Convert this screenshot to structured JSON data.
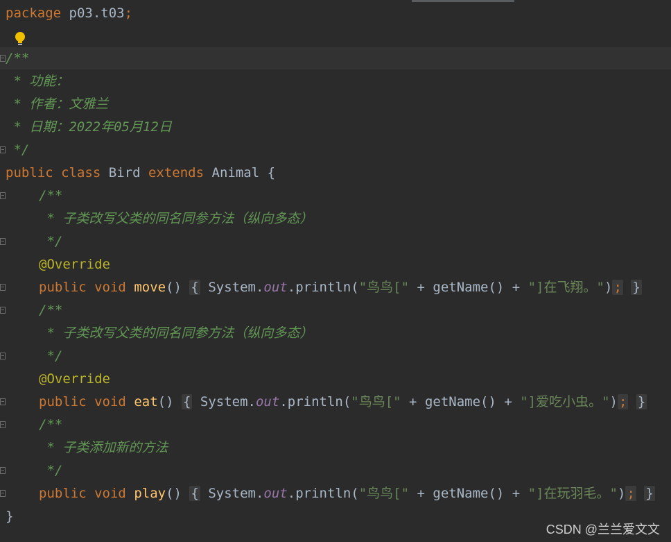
{
  "editor": {
    "lines": {
      "package_kw": "package",
      "package_name": " p03.t03",
      "package_semi": ";",
      "javadoc_open": "/**",
      "jd_l1": " * 功能：",
      "jd_l2": " * 作者：文雅兰",
      "jd_l3": " * 日期：2022年05月12日",
      "jd_close": " */",
      "class_public": "public",
      "class_kw": "class",
      "class_name": "Bird",
      "class_extends": "extends",
      "class_super": "Animal",
      "class_brace": " {",
      "m_doc_open": "/**",
      "m_doc_override": " * 子类改写父类的同名同参方法（纵向多态）",
      "m_doc_close": " */",
      "override": "@Override",
      "public": "public",
      "void": "void",
      "move": "move",
      "eat": "eat",
      "play": "play",
      "parens": "()",
      "open_brace": "{",
      "system": "System",
      "dot": ".",
      "out": "out",
      "println": "println(",
      "str_prefix": "\"鸟鸟[\"",
      "plus": " + ",
      "getName": "getName()",
      "str_move": "\"]在飞翔。\"",
      "str_eat": "\"]爱吃小虫。\"",
      "str_play": "\"]在玩羽毛。\"",
      "close_paren": ")",
      "semi": ";",
      "close_brace": "}",
      "play_doc": " * 子类添加新的方法",
      "class_close": "}"
    }
  },
  "watermark": "CSDN @兰兰爱文文",
  "colors": {
    "background": "#2b2b2b",
    "keyword": "#cc7832",
    "comment": "#629755",
    "annotation": "#bbb529",
    "string": "#6a8759",
    "field": "#9876aa",
    "method": "#ffc66d",
    "text": "#a9b7c6"
  }
}
